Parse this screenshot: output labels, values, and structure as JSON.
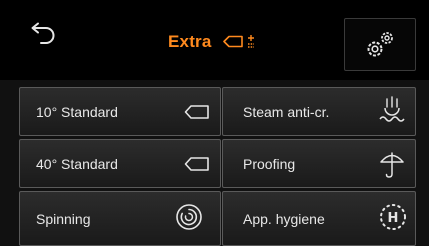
{
  "header": {
    "title": "Extra",
    "accent_color": "#ff8a1e",
    "back_icon": "back-arrow-icon",
    "mode_icon": "extra-plus-minus-icon",
    "settings_icon": "gears-icon"
  },
  "programs": [
    {
      "label": "10° Standard",
      "icon": "standard-tag-icon"
    },
    {
      "label": "Steam anti-cr.",
      "icon": "steam-icon"
    },
    {
      "label": "40° Standard",
      "icon": "standard-tag-icon"
    },
    {
      "label": "Proofing",
      "icon": "umbrella-icon"
    },
    {
      "label": "Spinning",
      "icon": "spin-icon"
    },
    {
      "label": "App. hygiene",
      "icon": "hygiene-icon"
    }
  ]
}
